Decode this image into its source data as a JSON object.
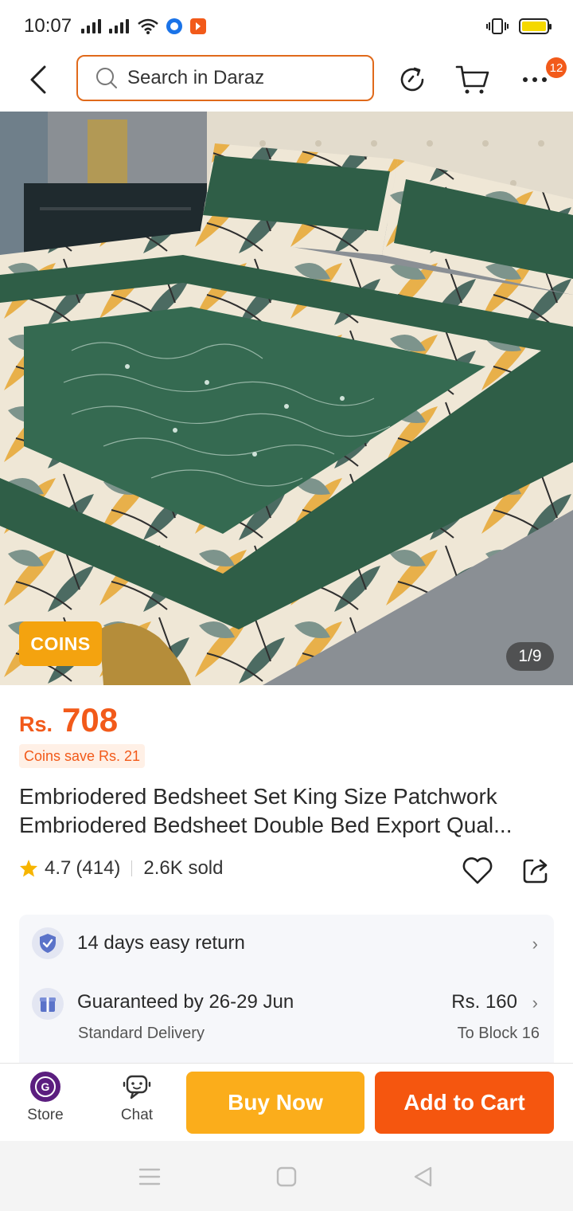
{
  "status_bar": {
    "time": "10:07"
  },
  "header": {
    "search_placeholder": "Search in Daraz",
    "cart_badge": "12"
  },
  "gallery": {
    "coins_tag": "COINS",
    "counter": "1/9"
  },
  "product": {
    "currency": "Rs.",
    "price": "708",
    "coins_save": "Coins save Rs. 21",
    "title_line1": "Embriodered Bedsheet Set King Size Patchwork",
    "title_line2": "Embriodered Bedsheet Double Bed Export Qual...",
    "rating": "4.7",
    "reviews": "(414)",
    "sold": "2.6K sold"
  },
  "services": {
    "return_text": "14 days easy return",
    "delivery_text": "Guaranteed by 26-29 Jun",
    "delivery_sub": "Standard Delivery",
    "delivery_price": "Rs. 160",
    "delivery_to": "To Block 16"
  },
  "actions": {
    "store_label": "Store",
    "chat_label": "Chat",
    "buy_now": "Buy Now",
    "add_to_cart": "Add to Cart"
  },
  "colors": {
    "brand_orange": "#f25a1a",
    "buy_now_yellow": "#fbad1b",
    "coins_yellow": "#f4a30f",
    "bedsheet_green": "#2f5e47"
  }
}
